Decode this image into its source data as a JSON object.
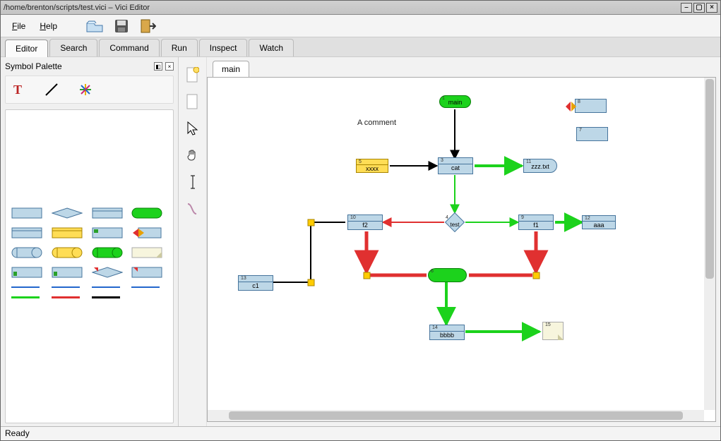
{
  "window": {
    "title": "/home/brenton/scripts/test.vici – Vici Editor"
  },
  "menus": {
    "file": "File",
    "help": "Help"
  },
  "main_tabs": {
    "editor": "Editor",
    "search": "Search",
    "command": "Command",
    "run": "Run",
    "inspect": "Inspect",
    "watch": "Watch"
  },
  "palette": {
    "title": "Symbol Palette"
  },
  "canvas": {
    "tab": "main",
    "comment": "A comment",
    "nodes": {
      "main": {
        "id": "1",
        "label": "main"
      },
      "xxxx": {
        "id": "5",
        "label": "xxxx"
      },
      "cat": {
        "id": "3",
        "label": "cat"
      },
      "zzz": {
        "id": "11",
        "label": "zzz.txt"
      },
      "decision": {
        "id": "4",
        "label": "test"
      },
      "f2": {
        "id": "10",
        "label": "f2"
      },
      "f1": {
        "id": "9",
        "label": "f1"
      },
      "aaa": {
        "id": "12",
        "label": "aaa"
      },
      "cyl": {
        "id": "6",
        "label": ""
      },
      "c1": {
        "id": "13",
        "label": "c1"
      },
      "bbbb": {
        "id": "14",
        "label": "bbbb"
      },
      "note": {
        "id": "15",
        "label": ""
      },
      "extra1": {
        "id": "8",
        "label": ""
      },
      "extra2": {
        "id": "7",
        "label": ""
      }
    }
  },
  "status": {
    "text": "Ready"
  }
}
